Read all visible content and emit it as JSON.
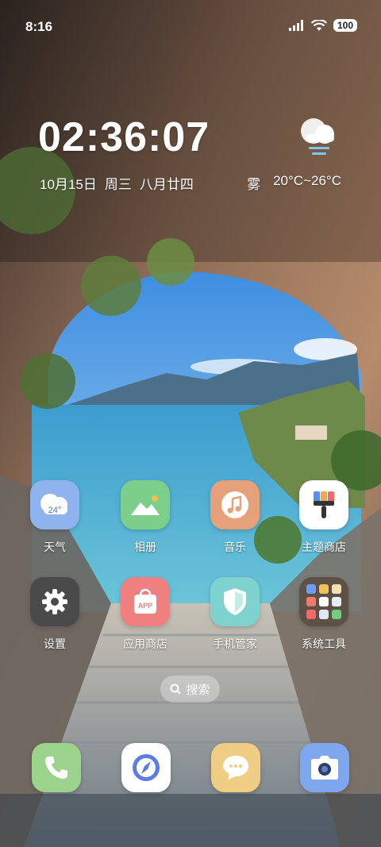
{
  "status_bar": {
    "time": "8:16",
    "battery": "100",
    "icons": [
      "signal-icon",
      "wifi-icon",
      "battery-icon"
    ]
  },
  "clock_widget": {
    "time": "02:36:07",
    "date": "10月15日",
    "weekday": "周三",
    "lunar_date": "八月廿四",
    "weather": "雾",
    "temperature": "20°C~26°C",
    "weather_icon": "fog-icon"
  },
  "apps": [
    {
      "label": "天气",
      "icon": "weather-icon",
      "color": "#8fb3ee",
      "badge": "24°"
    },
    {
      "label": "相册",
      "icon": "gallery-icon",
      "color": "#7ccf8a"
    },
    {
      "label": "音乐",
      "icon": "music-icon",
      "color": "#e6a17a"
    },
    {
      "label": "主题商店",
      "icon": "theme-icon",
      "color": "#ffffff"
    },
    {
      "label": "设置",
      "icon": "gear-icon",
      "color": "#4a4a4a"
    },
    {
      "label": "应用商店",
      "icon": "app-store-icon",
      "color": "#f08080",
      "badge": "APP"
    },
    {
      "label": "手机管家",
      "icon": "shield-icon",
      "color": "#7fd3cf"
    },
    {
      "label": "系统工具",
      "icon": "folder-icon",
      "color": "#5d5047"
    }
  ],
  "search": {
    "label": "搜索",
    "icon": "search-icon"
  },
  "dock": [
    {
      "icon": "phone-icon",
      "color": "#9bd38d"
    },
    {
      "icon": "browser-icon",
      "color": "#ffffff"
    },
    {
      "icon": "messages-icon",
      "color": "#efcd82"
    },
    {
      "icon": "camera-icon",
      "color": "#7fa7ee"
    }
  ]
}
